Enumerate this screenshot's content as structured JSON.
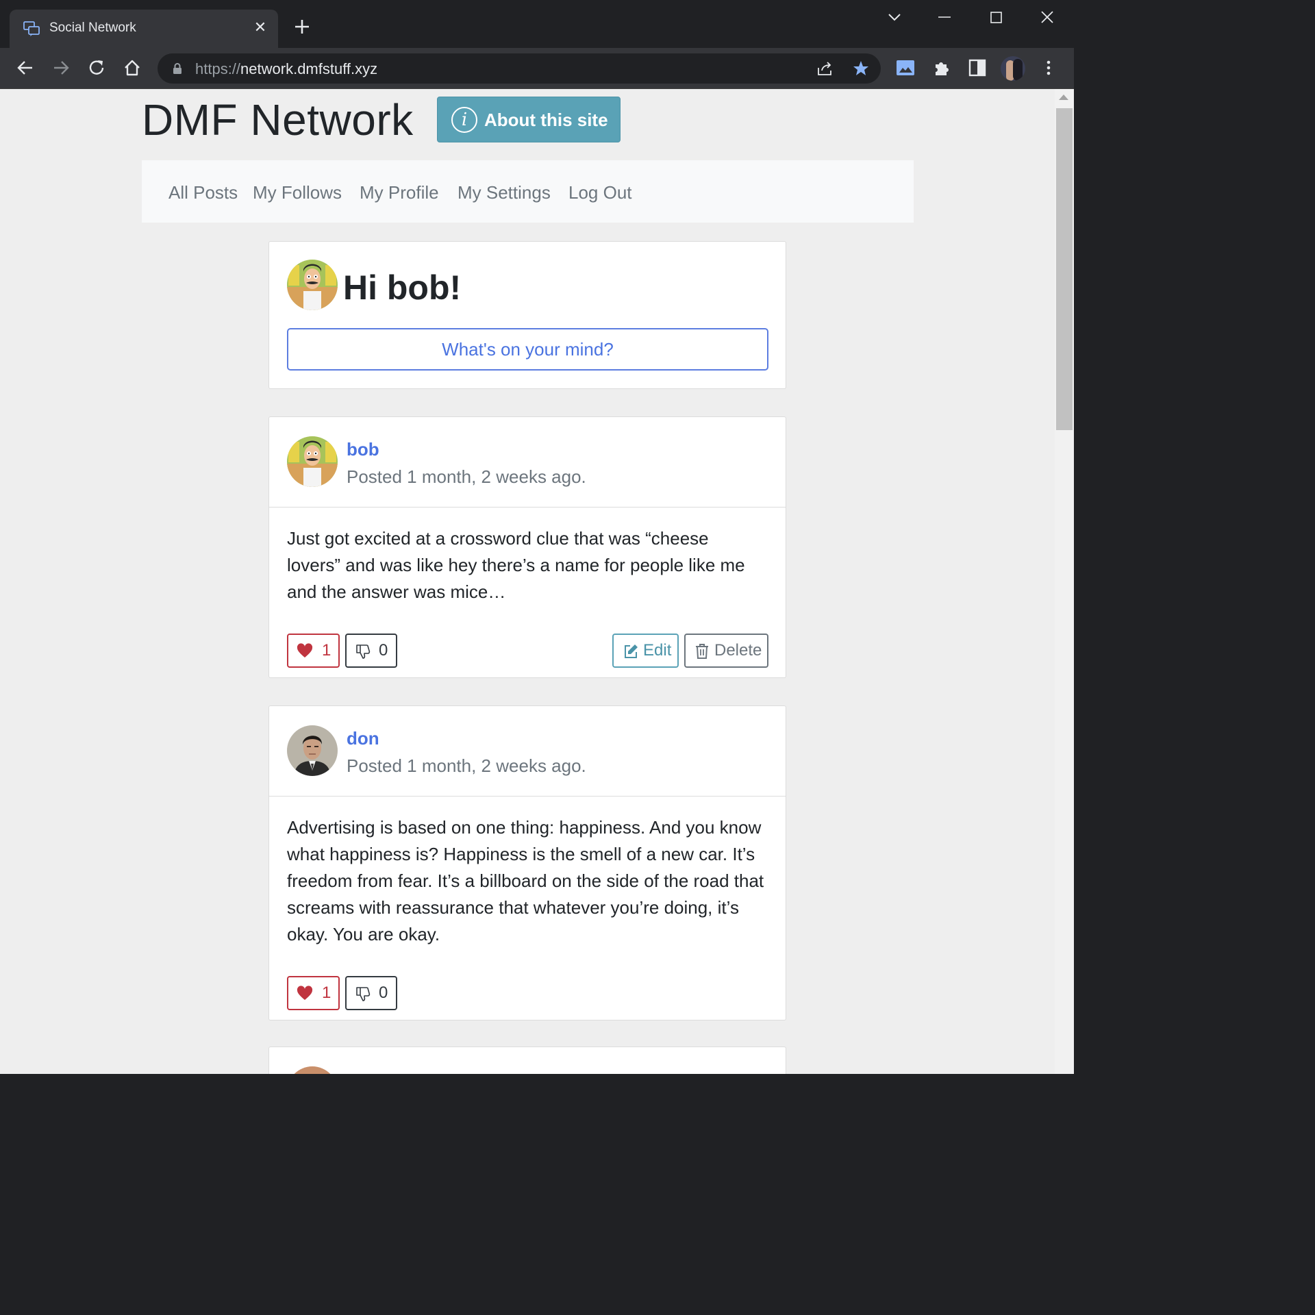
{
  "browser": {
    "tab_title": "Social Network",
    "url_scheme": "https://",
    "url_host": "network.dmfstuff.xyz"
  },
  "site": {
    "title": "DMF Network",
    "about_label": "About this site",
    "accent": "#5aa2b6"
  },
  "nav": {
    "items": [
      "All Posts",
      "My Follows",
      "My Profile",
      "My Settings",
      "Log Out"
    ]
  },
  "compose": {
    "greeting": "Hi bob!",
    "prompt": "What's on your mind?"
  },
  "posts": [
    {
      "user": "bob",
      "time": "Posted 1 month, 2 weeks ago.",
      "body": "Just got excited at a crossword clue that was “cheese lovers” and was like hey there’s a name for people like me and the answer was mice…",
      "likes": "1",
      "dislikes": "0",
      "edit_label": "Edit",
      "delete_label": "Delete"
    },
    {
      "user": "don",
      "time": "Posted 1 month, 2 weeks ago.",
      "body": "Advertising is based on one thing: happiness. And you know what happiness is? Happiness is the smell of a new car. It’s freedom from fear. It’s a billboard on the side of the road that screams with reassurance that whatever you’re doing, it’s okay. You are okay.",
      "likes": "1",
      "dislikes": "0"
    }
  ],
  "colors": {
    "like": "#c0343f",
    "link": "#4a73e0",
    "muted": "#6c757d"
  }
}
